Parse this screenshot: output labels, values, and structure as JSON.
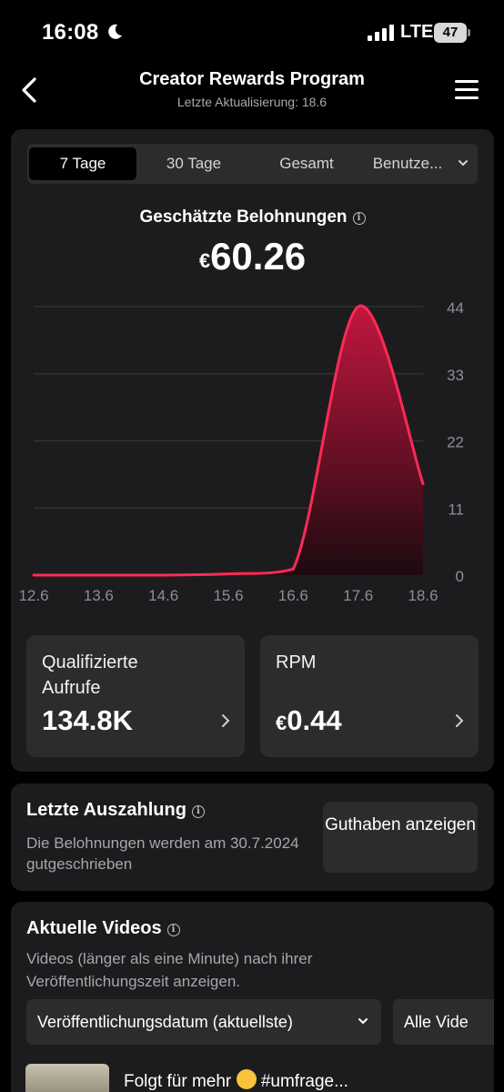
{
  "status_bar": {
    "time": "16:08",
    "network": "LTE",
    "battery": "47"
  },
  "header": {
    "title": "Creator Rewards Program",
    "subtitle": "Letzte Aktualisierung: 18.6"
  },
  "tabs": [
    "7 Tage",
    "30 Tage",
    "Gesamt",
    "Benutze..."
  ],
  "active_tab": "7 Tage",
  "estimated": {
    "title": "Geschätzte Belohnungen",
    "currency": "€",
    "value": "60.26"
  },
  "chart_data": {
    "type": "area",
    "x": [
      "12.6",
      "13.6",
      "14.6",
      "15.6",
      "16.6",
      "17.6",
      "18.6"
    ],
    "y": [
      0,
      0,
      0,
      0.2,
      1,
      44,
      15
    ],
    "y_ticks": [
      "44",
      "33",
      "22",
      "11",
      "0"
    ],
    "ylim": [
      0,
      44
    ],
    "grid": true,
    "line_color": "#ff2a55",
    "fill_top_color": "#c2173f",
    "fill_bottom_color": "#1e0a10"
  },
  "stats": [
    {
      "label": "Qualifizierte Aufrufe",
      "value": "134.8K",
      "currency": ""
    },
    {
      "label": "RPM",
      "value": "0.44",
      "currency": "€"
    }
  ],
  "payout": {
    "title": "Letzte Auszahlung",
    "description": "Die Belohnungen werden am 30.7.2024 gutgeschrieben",
    "button": "Guthaben anzeigen"
  },
  "videos": {
    "title": "Aktuelle Videos",
    "description": "Videos (länger als eine Minute) nach ihrer Veröffentlichungszeit anzeigen.",
    "filter_sort": "Veröffentlichungsdatum (aktuellste)",
    "filter_type": "Alle Vide",
    "first_video_caption_start": "Folgt für mehr",
    "first_video_caption_end": " #umfrage..."
  },
  "colors": {
    "background": "#000000",
    "card": "#1c1c1e",
    "accent": "#ff2a55"
  }
}
